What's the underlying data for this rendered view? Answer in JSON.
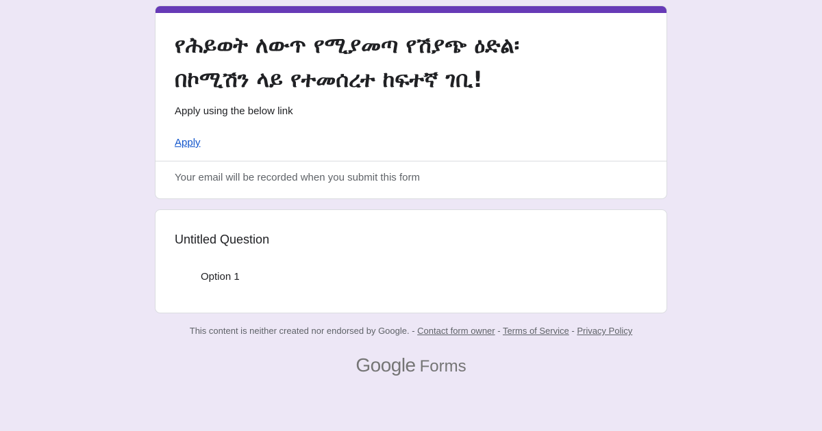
{
  "form": {
    "accent_color": "#673ab7",
    "title_line1": "የሕይወት ለውጥ የሚያመጣ የሽያጭ ዕድል፡",
    "title_line2": "በኮሚሽን ላይ የተመሰረተ ከፍተኛ ገቢ!",
    "description": "Apply using the below link",
    "apply_link": "Apply",
    "email_notice": "Your email will be recorded when you submit this form"
  },
  "question": {
    "title": "Untitled Question",
    "option": "Option 1"
  },
  "footer": {
    "disclaimer": "This content is neither created nor endorsed by Google.",
    "separator": " - ",
    "contact_link": "Contact form owner",
    "terms_link": "Terms of Service",
    "privacy_link": "Privacy Policy"
  },
  "brand": {
    "google": "Google",
    "forms": "Forms"
  }
}
